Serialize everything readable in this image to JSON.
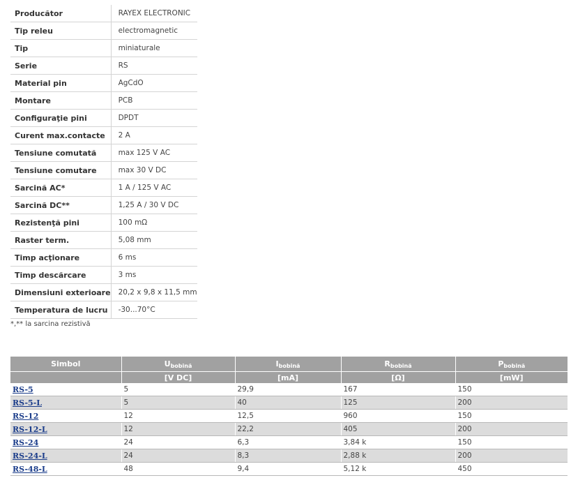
{
  "specs": [
    {
      "label": "Producător",
      "value": "RAYEX ELECTRONIC"
    },
    {
      "label": "Tip releu",
      "value": "electromagnetic"
    },
    {
      "label": "Tip",
      "value": "miniaturale"
    },
    {
      "label": "Serie",
      "value": "RS"
    },
    {
      "label": "Material pin",
      "value": "AgCdO"
    },
    {
      "label": "Montare",
      "value": "PCB"
    },
    {
      "label": "Configuraţie pini",
      "value": "DPDT"
    },
    {
      "label": "Curent max.contacte",
      "value": "2 A"
    },
    {
      "label": "Tensiune comutată",
      "value": "max 125 V AC"
    },
    {
      "label": "Tensiune comutare",
      "value": "max 30 V DC"
    },
    {
      "label": "Sarcină AC*",
      "value": "1 A / 125 V AC"
    },
    {
      "label": "Sarcină DC**",
      "value": "1,25 A / 30 V DC"
    },
    {
      "label": "Rezistenţă pini",
      "value": "100 mΩ"
    },
    {
      "label": "Raster term.",
      "value": "5,08 mm"
    },
    {
      "label": "Timp acţionare",
      "value": "6 ms"
    },
    {
      "label": "Timp descărcare",
      "value": "3 ms"
    },
    {
      "label": "Dimensiuni exterioare",
      "value": "20,2 x 9,8 x 11,5 mm"
    },
    {
      "label": "Temperatura de lucru",
      "value": "-30...70°C"
    }
  ],
  "note": "*,** la sarcina rezistivă",
  "coil_table": {
    "headers": [
      {
        "main": "Simbol",
        "sub": "",
        "unit": ""
      },
      {
        "main": "U",
        "sub": "bobină",
        "unit": "[V DC]"
      },
      {
        "main": "I",
        "sub": "bobină",
        "unit": "[mA]"
      },
      {
        "main": "R",
        "sub": "bobină",
        "unit": "[Ω]"
      },
      {
        "main": "P",
        "sub": "bobină",
        "unit": "[mW]"
      }
    ],
    "rows": [
      [
        "RS-5",
        "5",
        "29,9",
        "167",
        "150"
      ],
      [
        "RS-5-L",
        "5",
        "40",
        "125",
        "200"
      ],
      [
        "RS-12",
        "12",
        "12,5",
        "960",
        "150"
      ],
      [
        "RS-12-L",
        "12",
        "22,2",
        "405",
        "200"
      ],
      [
        "RS-24",
        "24",
        "6,3",
        "3,84 k",
        "150"
      ],
      [
        "RS-24-L",
        "24",
        "8,3",
        "2,88 k",
        "200"
      ],
      [
        "RS-48-L",
        "48",
        "9,4",
        "5,12 k",
        "450"
      ]
    ]
  },
  "colors": {
    "header_bg": "#a1a1a1",
    "alt_row_bg": "#dcdcdc",
    "link": "#1a3c8a"
  }
}
